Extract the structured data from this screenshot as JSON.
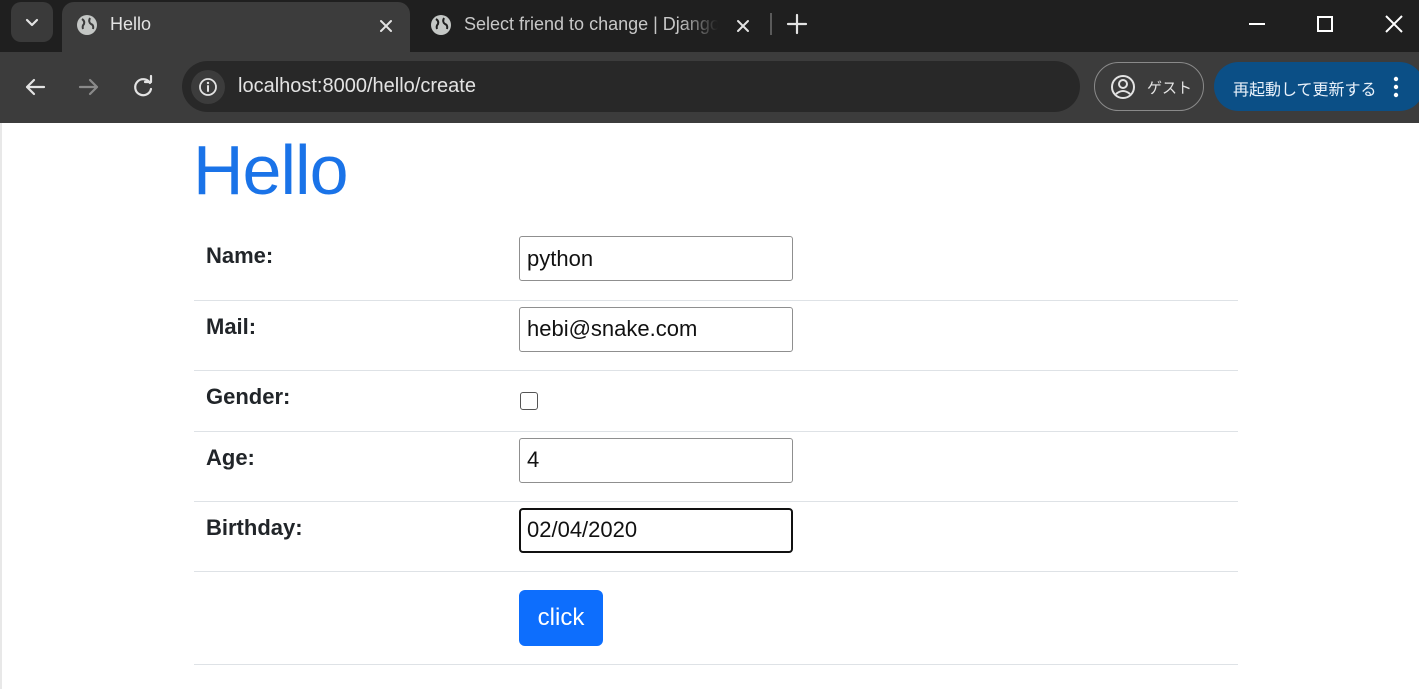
{
  "browser": {
    "tabs": [
      {
        "title": "Hello",
        "active": true
      },
      {
        "title": "Select friend to change | Django",
        "active": false
      }
    ],
    "url": "localhost:8000/hello/create",
    "profile_label": "ゲスト",
    "update_label": "再起動して更新する",
    "accent_color": "#0b4f86"
  },
  "page": {
    "heading": "Hello",
    "heading_color": "#1a73e8",
    "form": {
      "fields": [
        {
          "label": "Name:",
          "type": "text",
          "value": "python"
        },
        {
          "label": "Mail:",
          "type": "email",
          "value": "hebi@snake.com"
        },
        {
          "label": "Gender:",
          "type": "checkbox",
          "checked": false
        },
        {
          "label": "Age:",
          "type": "number",
          "value": "4"
        },
        {
          "label": "Birthday:",
          "type": "date",
          "value": "02/04/2020"
        }
      ],
      "submit_label": "click",
      "submit_color": "#0d6efd"
    }
  }
}
